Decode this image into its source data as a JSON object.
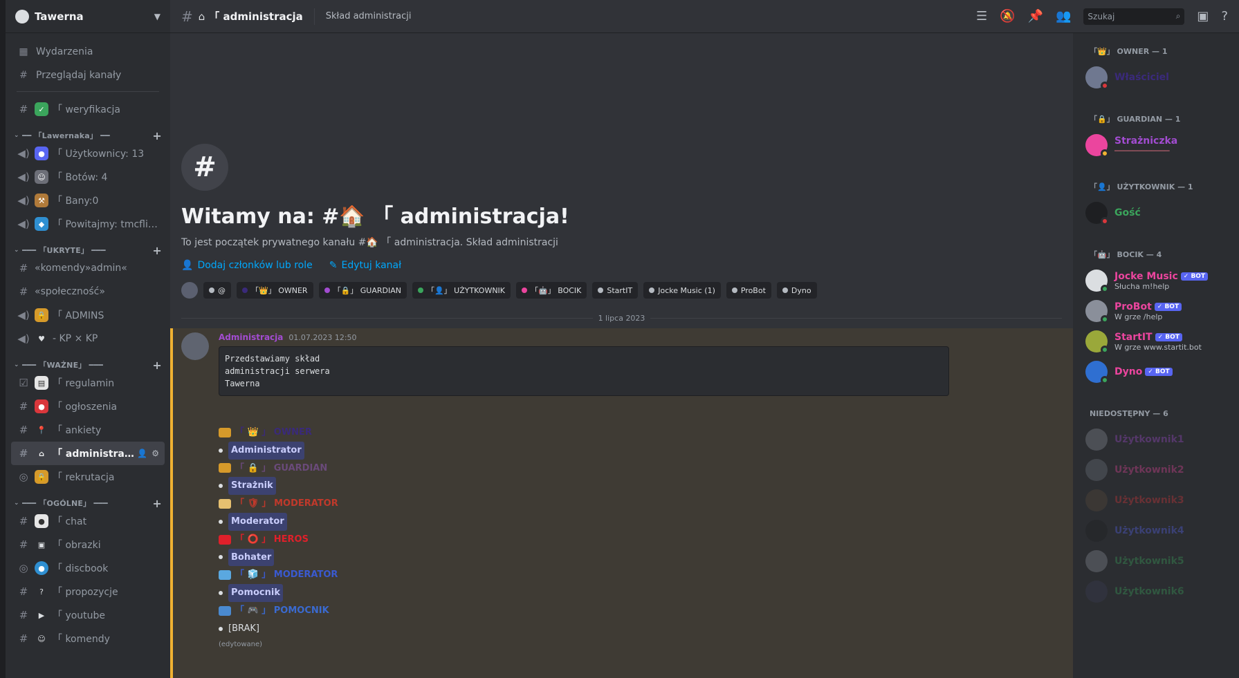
{
  "server": {
    "name": "Tawerna"
  },
  "nav": {
    "events": "Wydarzenia",
    "browse": "Przeglądaj kanały"
  },
  "channels": {
    "verify": "「 weryfikacja",
    "cat1": "━━ 「Lawernaka」 ━━",
    "users": "「 Użytkownicy: 13",
    "bots": "「 Botów: 4",
    "bans": "「 Bany:0",
    "welcome": "「 Powitajmy: tmcflia...",
    "cat2": "━━━ 「UKRYTE」 ━━━",
    "cmd_admin": "«komendy»admin«",
    "community": "«społeczność»",
    "admins": "「 ADMINS",
    "kp": "- KP × KP",
    "cat3": "━━━ 「WAŻNE」 ━━━",
    "rules": "「 regulamin",
    "announce": "「 ogłoszenia",
    "polls": "「 ankiety",
    "admin": "「 administracja",
    "recruit": "「 rekrutacja",
    "cat4": "━━━ 「OGÓLNE」 ━━━",
    "chat": "「 chat",
    "images": "「 obrazki",
    "discbook": "「 discbook",
    "proposals": "「 propozycje",
    "youtube": "「 youtube",
    "commands": "「 komendy"
  },
  "topbar": {
    "channel": "「 administracja",
    "topic": "Skład administracji",
    "search_placeholder": "Szukaj"
  },
  "welcome": {
    "title": "Witamy na: #🏠 「 administracja!",
    "subtitle": "To jest początek prywatnego kanału #🏠 「 administracja. Skład administracji",
    "add_members": "Dodaj członków lub role",
    "edit_channel": "Edytuj kanał",
    "chips": [
      "@",
      "「👑」 OWNER",
      "「🔒」 GUARDIAN",
      "「👤」 UŻYTKOWNIK",
      "「🤖」 BOCIK",
      "StartIT",
      "Jocke Music (1)",
      "ProBot",
      "Dyno"
    ]
  },
  "date_divider": "1 lipca 2023",
  "message": {
    "author": "Administracja",
    "time": "01.07.2023 12:50",
    "code": "Przedstawiamy skład\nadministracji serwera\nTawerna",
    "roles": [
      {
        "label": "「 👑 」 OWNER",
        "member": "Administrator"
      },
      {
        "label": "「 🔒 」 GUARDIAN",
        "member": "Strażnik"
      },
      {
        "label": "「 🛡 」 MODERATOR",
        "member": "Moderator"
      },
      {
        "label": "「 ⭕ 」 HEROS",
        "member": "Bohater"
      },
      {
        "label": "「 🧊 」 MODERATOR",
        "member": "Pomocnik"
      },
      {
        "label": "「 🎮 」 POMOCNIK",
        "member": "[BRAK]"
      }
    ],
    "edited": "(edytowane)"
  },
  "members": {
    "owner_group": "「👑」 OWNER — 1",
    "owner": "Właściciel",
    "guardian_group": "「🔒」 GUARDIAN — 1",
    "guardian": "Strażniczka",
    "guardian_sub": "────────────",
    "user_group": "「👤」 UŻYTKOWNIK — 1",
    "user": "Gość",
    "bot_group": "「🤖」 BOCIK — 4",
    "bot1": "Jocke Music",
    "bot1_sub": "Słucha m!help",
    "bot2": "ProBot",
    "bot2_sub": "W grze /help",
    "bot3": "StartIT",
    "bot3_sub": "W grze www.startit.bot",
    "bot4": "Dyno",
    "bot_badge": "✓ BOT",
    "offline_group": "NIEDOSTĘPNY — 6",
    "off1": "Użytkownik1",
    "off2": "Użytkownik2",
    "off3": "Użytkownik3",
    "off4": "Użytkownik4",
    "off5": "Użytkownik5",
    "off6": "Użytkownik6"
  }
}
